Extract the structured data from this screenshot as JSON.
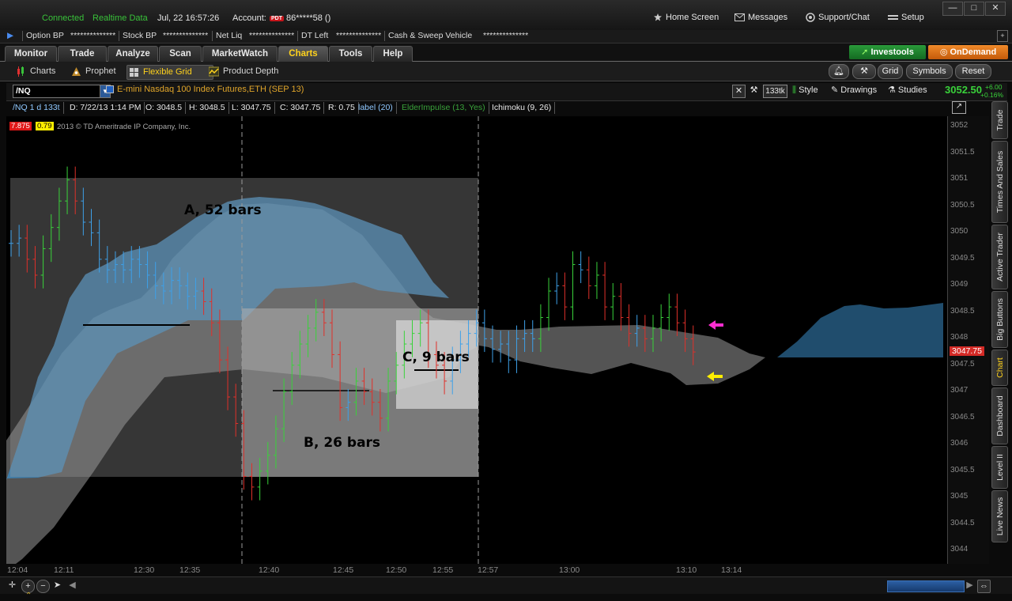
{
  "status": {
    "connected": "Connected",
    "realtime": "Realtime Data",
    "datetime": "Jul, 22  16:57:26",
    "account_label": "Account:",
    "account_badge": "PDT",
    "account_value": "86*****58 ()",
    "nav": [
      "Home Screen",
      "Messages",
      "Support/Chat",
      "Setup"
    ]
  },
  "account_bar": {
    "items": [
      "Option BP",
      "**************",
      "Stock BP",
      "**************",
      "Net Liq",
      "**************",
      "DT Left",
      "**************",
      "Cash & Sweep Vehicle",
      "**************"
    ]
  },
  "tabs": [
    "Monitor",
    "Trade",
    "Analyze",
    "Scan",
    "MarketWatch",
    "Charts",
    "Tools",
    "Help"
  ],
  "active_tab": "Charts",
  "promos": [
    "Investools",
    "OnDemand"
  ],
  "subtabs": [
    "Charts",
    "Prophet",
    "Flexible Grid",
    "Product Depth"
  ],
  "active_subtab": "Flexible Grid",
  "sub_right_buttons": [
    "Grid",
    "Symbols",
    "Reset"
  ],
  "symbol": {
    "value": "/NQ",
    "description": "E-mini Nasdaq 100 Index Futures,ETH (SEP 13)",
    "tools": [
      "133tk",
      "Style",
      "Drawings",
      "Studies"
    ],
    "last_price": "3052.50",
    "change": "+6.00",
    "change_pct": "+0.16%"
  },
  "readout": {
    "chart_label": "/NQ 1 d 133t",
    "date": "D: 7/22/13 1:14 PM",
    "open": "O: 3048.5",
    "high": "H: 3048.5",
    "low": "L: 3047.75",
    "close": "C: 3047.75",
    "range": "R: 0.75",
    "label": "label (20)",
    "elder": "ElderImpulse (13, Yes)",
    "ichimoku": "Ichimoku (9, 26)",
    "badge_red": "7.875",
    "badge_yellow": "0.79",
    "copyright": "2013 © TD Ameritrade IP Company, Inc."
  },
  "colors": {
    "up": "#39d23a",
    "down": "#e0302a",
    "neutral": "#3ea0e8",
    "cloud_blue": "#3b8cc7",
    "cloud_gray": "#707070",
    "magenta_arrow": "#ff2ed1",
    "yellow_arrow": "#ffee00",
    "price_tag": "#d42a26"
  },
  "chart_data": {
    "type": "ohlc",
    "annotations": [
      "A, 52 bars",
      "B, 26 bars",
      "C, 9 bars"
    ],
    "price_ticks": [
      "3052",
      "3051.5",
      "3051",
      "3050.5",
      "3050",
      "3049.5",
      "3049",
      "3048.5",
      "3048",
      "3047.5",
      "3047",
      "3046.5",
      "3046",
      "3045.5",
      "3045",
      "3044.5",
      "3044"
    ],
    "current_price_label": "3047.75",
    "ylim": [
      3043.75,
      3052.2
    ],
    "time_ticks": [
      "12:04",
      "12:11",
      "12:30",
      "12:35",
      "12:40",
      "12:45",
      "12:50",
      "12:55",
      "12:57",
      "13:00",
      "13:10",
      "13:14"
    ],
    "bar_closes_approx": [
      3049.8,
      3049.9,
      3049.5,
      3049.2,
      3049.7,
      3050.1,
      3050.6,
      3051.0,
      3050.6,
      3050.2,
      3050.0,
      3049.5,
      3049.3,
      3049.4,
      3049.3,
      3049.5,
      3049.4,
      3049.2,
      3049.0,
      3048.9,
      3049.1,
      3049.0,
      3048.8,
      3048.9,
      3048.7,
      3048.3,
      3047.6,
      3046.9,
      3046.4,
      3045.4,
      3045.2,
      3045.5,
      3045.8,
      3046.3,
      3047.0,
      3047.5,
      3047.9,
      3048.2,
      3048.5,
      3048.3,
      3047.7,
      3046.7,
      3046.8,
      3047.2,
      3047.0,
      3046.8,
      3046.5,
      3047.2,
      3047.5,
      3047.9,
      3048.1,
      3048.3,
      3047.7,
      3047.5,
      3047.2,
      3047.6,
      3047.9,
      3048.1,
      3048.3,
      3048.0,
      3047.8,
      3047.9,
      3047.6,
      3048.0,
      3048.1,
      3048.0,
      3048.4,
      3048.9,
      3049.0,
      3048.6,
      3049.4,
      3049.3,
      3049.0,
      3049.2,
      3048.6,
      3048.8,
      3048.4,
      3048.1,
      3048.2,
      3048.0,
      3048.2,
      3048.4,
      3048.6,
      3048.3,
      3048.0,
      3047.75
    ]
  },
  "side_tabs": [
    "Trade",
    "Times And Sales",
    "Active Trader",
    "Big Buttons",
    "Chart",
    "Dashboard",
    "Level II",
    "Live News"
  ],
  "active_side_tab": "Chart"
}
